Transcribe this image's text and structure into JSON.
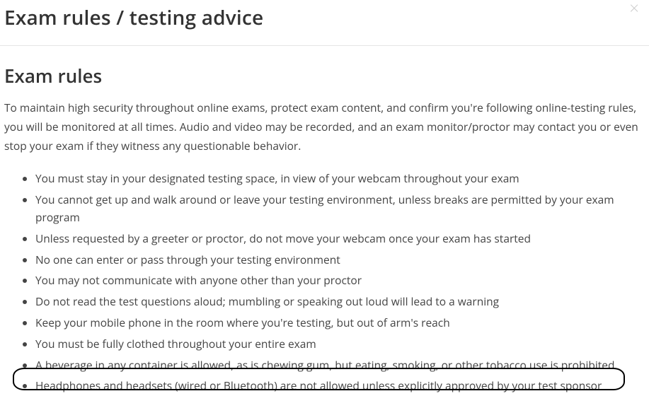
{
  "header": {
    "title": "Exam rules / testing advice"
  },
  "section": {
    "heading": "Exam rules",
    "intro": "To maintain high security throughout online exams, protect exam content, and confirm you're following online-testing rules, you will be monitored at all times. Audio and video may be recorded, and an exam monitor/proctor may contact you or even stop your exam if they witness any questionable behavior.",
    "rules": [
      "You must stay in your designated testing space, in view of your webcam throughout your exam",
      "You cannot get up and walk around or leave your testing environment, unless breaks are permitted by your exam program",
      "Unless requested by a greeter or proctor, do not move your webcam once your exam has started",
      "No one can enter or pass through your testing environment",
      "You may not communicate with anyone other than your proctor",
      "Do not read the test questions aloud; mumbling or speaking out loud will lead to a warning",
      "Keep your mobile phone in the room where you're testing, but out of arm's reach",
      "You must be fully clothed throughout your entire exam",
      "A beverage in any container is allowed, as is chewing gum, but eating, smoking, or other tobacco use is prohibited",
      "Headphones and headsets (wired or Bluetooth) are not allowed unless explicitly approved by your test sponsor"
    ]
  }
}
